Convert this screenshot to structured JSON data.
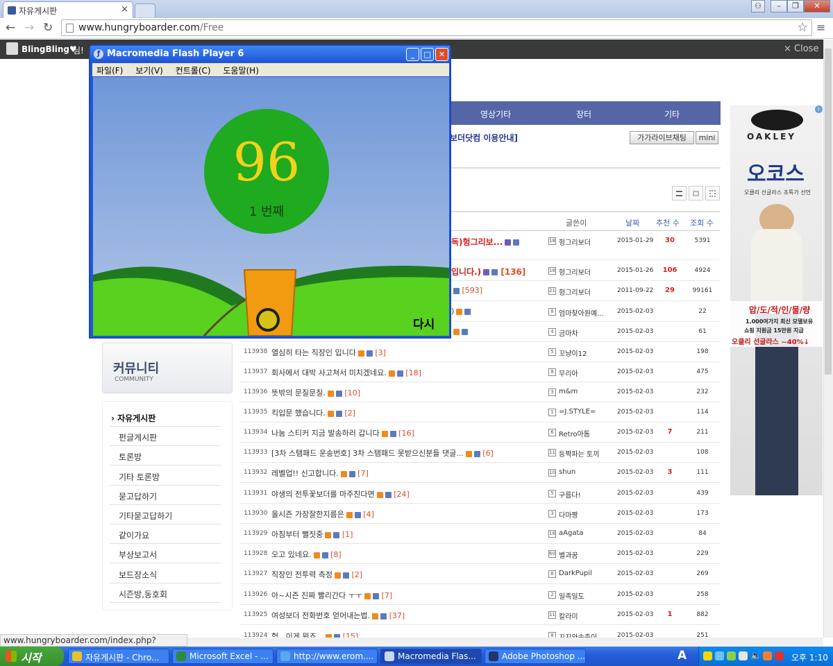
{
  "browser": {
    "tab_title": "자유게시판",
    "tab_close": "×",
    "url_host": "www.hungryboarder.com",
    "url_path": "/Free",
    "status_url": "www.hungryboarder.com/index.php?mid=Carpool"
  },
  "site": {
    "user_name": "BlingBling♥",
    "user_suffix": "님!",
    "close_label": "× Close",
    "nav": [
      "영상기타",
      "장터",
      "기타"
    ],
    "notice_link": "보더닷컴 이용안내]",
    "chat_button": "가가라이브채팅",
    "mini_button": "mini",
    "columns": {
      "writer": "글쓴이",
      "date": "날짜",
      "recommend": "추천 수",
      "views": "조회 수"
    },
    "sidebar_title": "커뮤니티",
    "sidebar_subtitle": "COMMUNITY",
    "sidebar_items": [
      "› 자유게시판",
      "펀글게시판",
      "토론방",
      "기타 토론방",
      "묻고답하기",
      "기타묻고답하기",
      "같이가요",
      "부상보고서",
      "보드장소식",
      "시즌방,동호회"
    ]
  },
  "posts": [
    {
      "num": "",
      "title": "독)헝그리보...",
      "comments": "",
      "writer": "헝그리보더",
      "level": "18",
      "date": "2015-01-29",
      "rec": "30",
      "views": "5391",
      "red": true
    },
    {
      "num": "",
      "title": "입니다.)",
      "comments": "[136]",
      "writer": "헝그리보더",
      "level": "18",
      "date": "2015-01-26",
      "rec": "106",
      "views": "4924",
      "red": true
    },
    {
      "num": "",
      "title": "",
      "comments": "[593]",
      "writer": "헝그리보더",
      "level": "21",
      "date": "2011-09-22",
      "rec": "29",
      "views": "99161",
      "red": false
    },
    {
      "num": "",
      "title": ")",
      "comments": "",
      "writer": "엄마찾아원예...",
      "level": "8",
      "date": "2015-02-03",
      "rec": "",
      "views": "22",
      "red": false
    },
    {
      "num": "",
      "title": "",
      "comments": "",
      "writer": "금마차",
      "level": "4",
      "date": "2015-02-03",
      "rec": "",
      "views": "61",
      "red": false
    },
    {
      "num": "113938",
      "title": "열심히 타는 직장인 입니다",
      "comments": "[3]",
      "writer": "꼬냥이12",
      "level": "5",
      "date": "2015-02-03",
      "rec": "",
      "views": "198",
      "red": false
    },
    {
      "num": "113937",
      "title": "회사에서 대박 사고쳐서 미치겠네요.",
      "comments": "[18]",
      "writer": "무리아",
      "level": "8",
      "date": "2015-02-03",
      "rec": "",
      "views": "475",
      "red": false
    },
    {
      "num": "113936",
      "title": "뜻밖의 문질문질.",
      "comments": "[10]",
      "writer": "m&m",
      "level": "3",
      "date": "2015-02-03",
      "rec": "",
      "views": "232",
      "red": false
    },
    {
      "num": "113935",
      "title": "킥입문 했습니다.",
      "comments": "[2]",
      "writer": "=J.STYLE=",
      "level": "1",
      "date": "2015-02-03",
      "rec": "",
      "views": "114",
      "red": false
    },
    {
      "num": "113934",
      "title": "나눔 스티커 지금 발송하러 갑니다",
      "comments": "[16]",
      "writer": "Retro아톰",
      "level": "6",
      "date": "2015-02-03",
      "rec": "7",
      "views": "211",
      "red": false
    },
    {
      "num": "113933",
      "title": "[3차 스탬패드 운송번호] 3차 스탬패드 못받으신분들 댓글...",
      "comments": "[6]",
      "writer": "등짝파는 토끼",
      "level": "11",
      "date": "2015-02-03",
      "rec": "",
      "views": "108",
      "red": false
    },
    {
      "num": "113932",
      "title": "레벨업!! 신고합니다.",
      "comments": "[7]",
      "writer": "shun",
      "level": "10",
      "date": "2015-02-03",
      "rec": "3",
      "views": "111",
      "red": false
    },
    {
      "num": "113931",
      "title": "야생의 전투꽃보더를 마주친다면",
      "comments": "[24]",
      "writer": "구름다!",
      "level": "5",
      "date": "2015-02-03",
      "rec": "",
      "views": "439",
      "red": false
    },
    {
      "num": "113930",
      "title": "올시즌 가장잘한지름은",
      "comments": "[4]",
      "writer": "다마짱",
      "level": "3",
      "date": "2015-02-03",
      "rec": "",
      "views": "173",
      "red": false
    },
    {
      "num": "113929",
      "title": "아침부터 뻘짓중",
      "comments": "[1]",
      "writer": "aAgata",
      "level": "18",
      "date": "2015-02-03",
      "rec": "",
      "views": "84",
      "red": false
    },
    {
      "num": "113928",
      "title": "오고 있네요.",
      "comments": "[8]",
      "writer": "별과꿈",
      "level": "60",
      "date": "2015-02-03",
      "rec": "",
      "views": "229",
      "red": false
    },
    {
      "num": "113927",
      "title": "직장인 전투력 측정",
      "comments": "[2]",
      "writer": "DarkPupil",
      "level": "6",
      "date": "2015-02-03",
      "rec": "",
      "views": "269",
      "red": false
    },
    {
      "num": "113926",
      "title": "아~시즌 진짜 빨리간다 ㅜㅜ",
      "comments": "[7]",
      "writer": "일족일도",
      "level": "2",
      "date": "2015-02-03",
      "rec": "",
      "views": "258",
      "red": false
    },
    {
      "num": "113925",
      "title": "여성보더 전화번호 얻어내는법.",
      "comments": "[37]",
      "writer": "칼라미",
      "level": "11",
      "date": "2015-02-03",
      "rec": "1",
      "views": "882",
      "red": false
    },
    {
      "num": "113924",
      "title": "헉.. 이게 뭐죠...",
      "comments": "[15]",
      "writer": "꼬지와송충이",
      "level": "8",
      "date": "2015-02-03",
      "rec": "",
      "views": "251",
      "red": false
    }
  ],
  "flash": {
    "title": "Macromedia Flash Player 6",
    "menu": [
      "파일(F)",
      "보기(V)",
      "컨트롤(C)",
      "도움말(H)"
    ],
    "score": "96",
    "rank": "1  번째",
    "retry": "다시"
  },
  "ad": {
    "brand": "OAKLEY",
    "headline": "오코스",
    "subline": "오클리 선글라스 초특가 선언",
    "promo1": "압/도/적/인/물/량",
    "promo2": "1,000여가지 최신 모델보유",
    "promo3": "쇼핑 지원금 15만원 지급",
    "promo4": "오클리 선글라스 ~40%↓"
  },
  "taskbar": {
    "start": "시작",
    "tasks": [
      "자유게시판 - Chro...",
      "Microsoft Excel - ...",
      "http://www.erom....",
      "Macromedia Flas...",
      "Adobe Photoshop ..."
    ],
    "ime": "A",
    "time": "오후 1:10"
  },
  "colors": {
    "nav": "#5566a7",
    "accent_red": "#d21f1f",
    "comment": "#e04a2a",
    "taskbar": "#245edb",
    "flash_ball": "#1faa1f",
    "score": "#f2d21b"
  }
}
